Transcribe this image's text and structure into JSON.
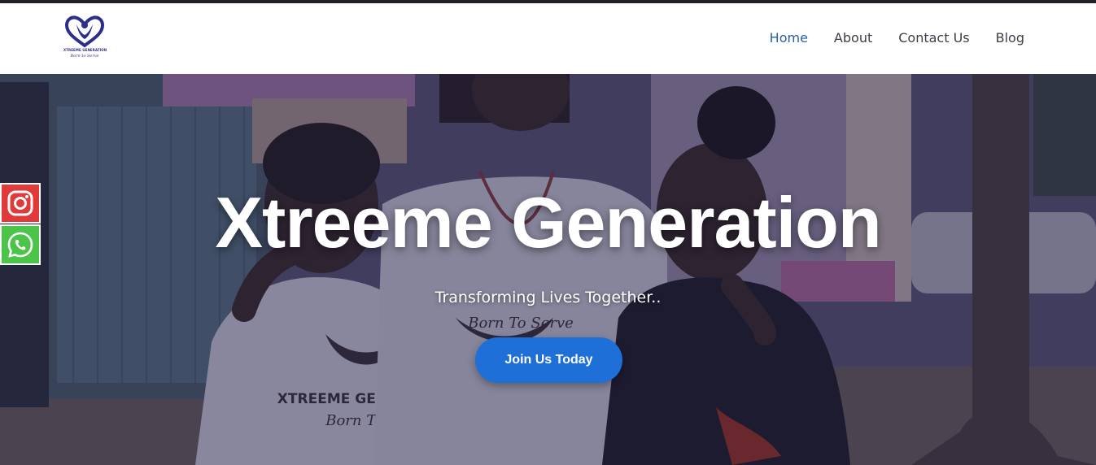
{
  "brand": {
    "name": "XTREEME GENERATION",
    "tagline": "Born to Serve",
    "logo_color": "#2b2f8a"
  },
  "nav": {
    "items": [
      {
        "label": "Home",
        "active": true
      },
      {
        "label": "About",
        "active": false
      },
      {
        "label": "Contact Us",
        "active": false
      },
      {
        "label": "Blog",
        "active": false
      }
    ],
    "active_color": "#2a5ea6"
  },
  "hero": {
    "title": "Xtreeme Generation",
    "subtitle": "Transforming Lives Together..",
    "cta_label": "Join Us Today",
    "cta_color": "#1f6fd8",
    "shirt_text": "XTREEME GENERATION",
    "shirt_tagline": "Born To Serve"
  },
  "social": {
    "items": [
      {
        "icon": "instagram-icon",
        "color": "#e03a3a"
      },
      {
        "icon": "whatsapp-icon",
        "color": "#4cc44a"
      }
    ]
  }
}
